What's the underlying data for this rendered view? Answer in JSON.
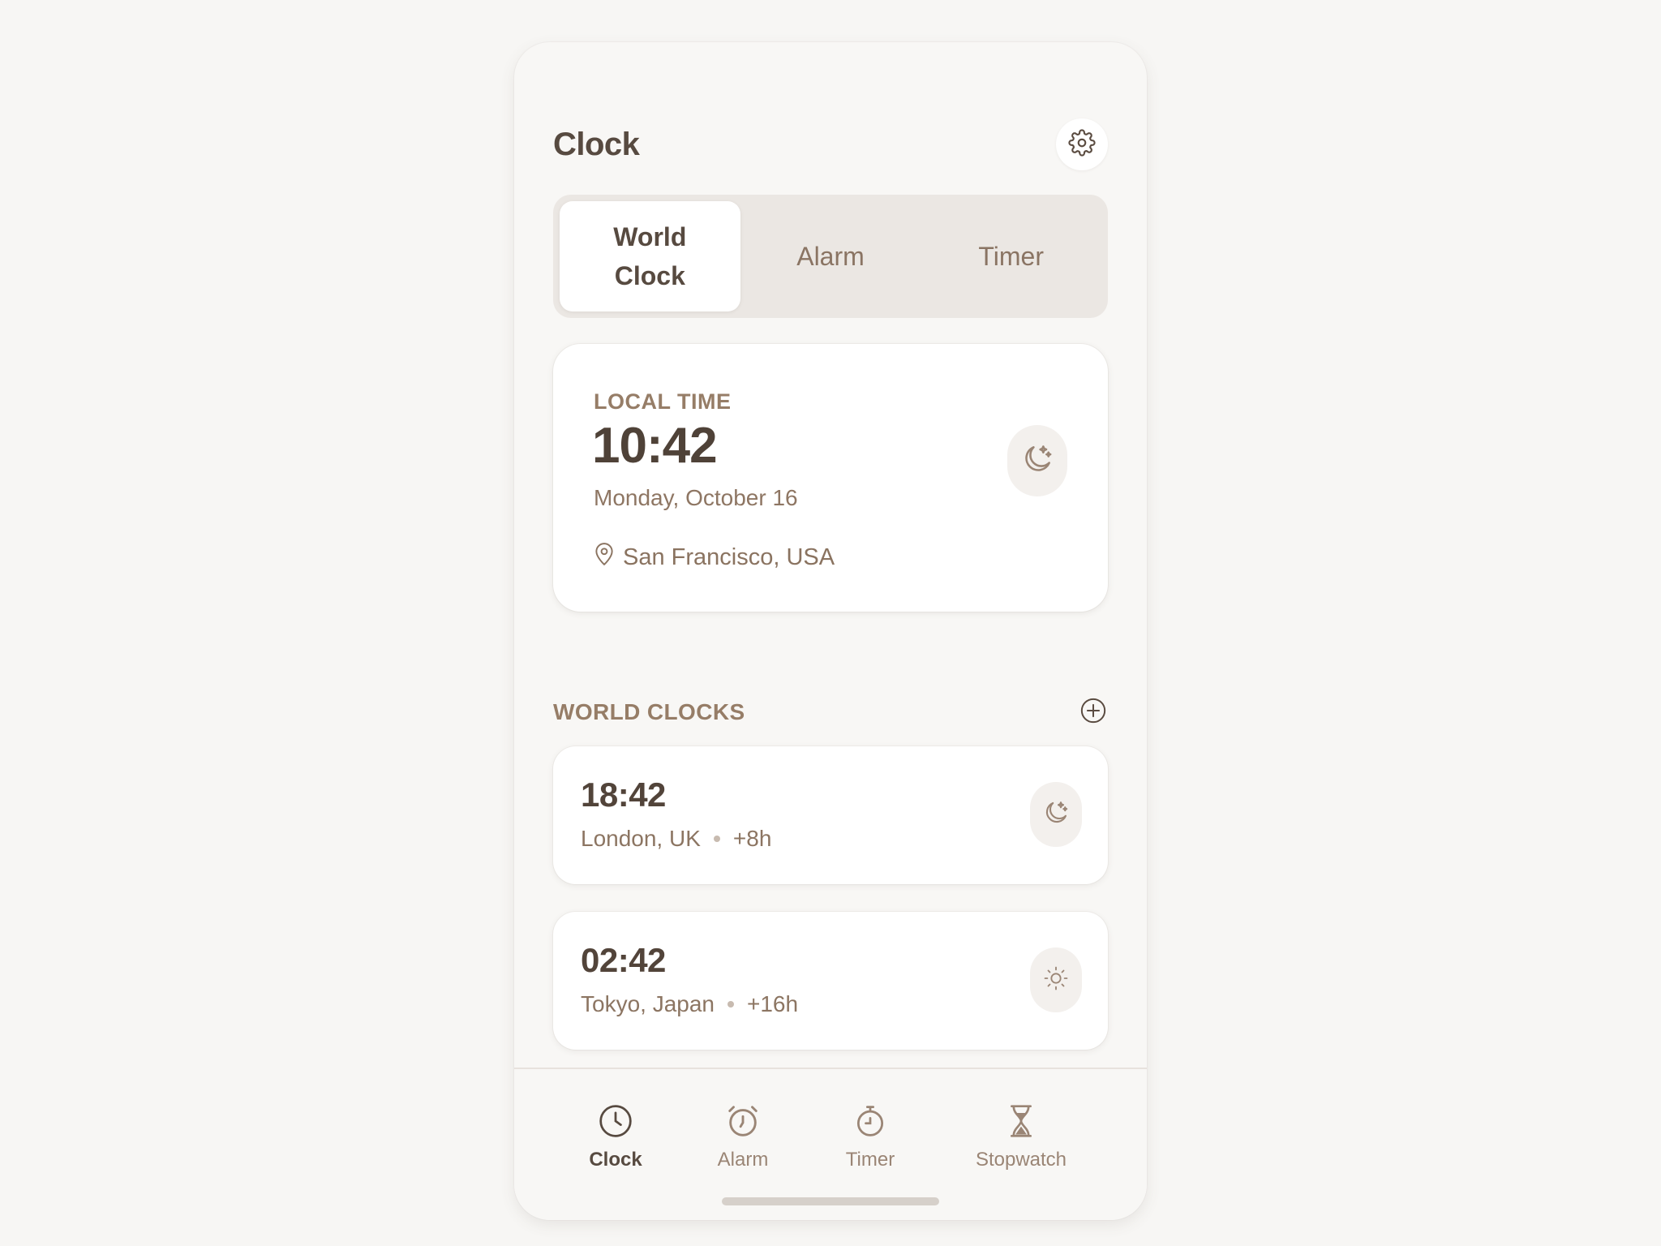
{
  "app": {
    "title": "Clock"
  },
  "header": {
    "settings_icon": "gear-icon"
  },
  "segments": [
    {
      "label": "World Clock",
      "active": true
    },
    {
      "label": "Alarm",
      "active": false
    },
    {
      "label": "Timer",
      "active": false
    }
  ],
  "local": {
    "label": "LOCAL TIME",
    "time": "10:42",
    "date": "Monday, October 16",
    "location": "San Francisco, USA",
    "period_icon": "moon-stars-icon",
    "location_icon": "map-pin-icon"
  },
  "world": {
    "section_title": "WORLD CLOCKS",
    "add_icon": "plus-circle-icon",
    "items": [
      {
        "time": "18:42",
        "city": "London, UK",
        "offset": "+8h",
        "period_icon": "moon-stars-icon"
      },
      {
        "time": "02:42",
        "city": "Tokyo, Japan",
        "offset": "+16h",
        "period_icon": "sun-icon"
      }
    ]
  },
  "tabbar": {
    "items": [
      {
        "label": "Clock",
        "icon": "clock-icon",
        "active": true
      },
      {
        "label": "Alarm",
        "icon": "alarm-clock-icon",
        "active": false
      },
      {
        "label": "Timer",
        "icon": "timer-icon",
        "active": false
      },
      {
        "label": "Stopwatch",
        "icon": "hourglass-icon",
        "active": false
      }
    ]
  },
  "colors": {
    "background": "#f7f6f4",
    "card": "#ffffff",
    "text_primary": "#574a40",
    "text_secondary": "#8c7562",
    "segmented_bg": "#ebe7e3"
  }
}
